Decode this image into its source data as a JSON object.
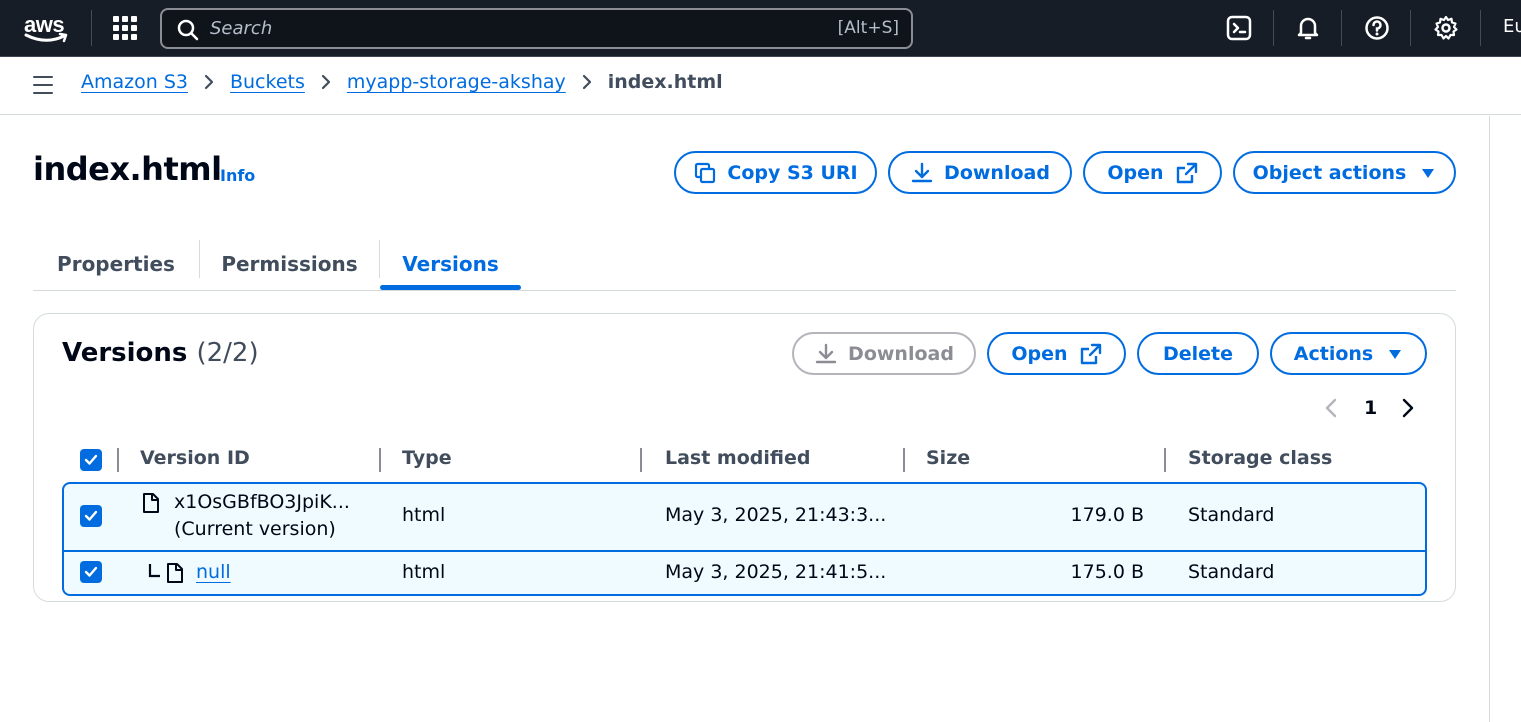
{
  "topnav": {
    "logo_text": "aws",
    "search": {
      "placeholder": "Search",
      "value": "",
      "shortcut": "[Alt+S]"
    },
    "region_label": "Eu",
    "icons": [
      "apps-grid-icon",
      "cloudshell-icon",
      "notifications-bell-icon",
      "help-icon",
      "settings-gear-icon"
    ]
  },
  "breadcrumb": {
    "items": [
      {
        "label": "Amazon S3"
      },
      {
        "label": "Buckets"
      },
      {
        "label": "myapp-storage-akshay"
      }
    ],
    "current": "index.html"
  },
  "header": {
    "title": "index.html",
    "info_label": "Info",
    "buttons": {
      "copy_uri": "Copy S3 URI",
      "download": "Download",
      "open": "Open",
      "object_actions": "Object actions"
    }
  },
  "tabs": [
    {
      "label": "Properties",
      "active": false
    },
    {
      "label": "Permissions",
      "active": false
    },
    {
      "label": "Versions",
      "active": true
    }
  ],
  "versions": {
    "title": "Versions",
    "count": "(2/2)",
    "buttons": {
      "download": "Download",
      "open": "Open",
      "delete": "Delete",
      "actions": "Actions"
    },
    "pagination": {
      "current_page": "1"
    },
    "columns": [
      "Version ID",
      "Type",
      "Last modified",
      "Size",
      "Storage class"
    ],
    "rows": [
      {
        "version_id": "x1OsGBfBO3JpiK...",
        "note": "(Current version)",
        "type": "html",
        "last_modified": "May 3, 2025, 21:43:3...",
        "size": "179.0 B",
        "storage_class": "Standard",
        "selected": true
      },
      {
        "version_id": "null",
        "type": "html",
        "last_modified": "May 3, 2025, 21:41:5...",
        "size": "175.0 B",
        "storage_class": "Standard",
        "selected": true
      }
    ]
  },
  "colors": {
    "accent": "#006ce0",
    "nav_bg": "#161d26",
    "selected_row_bg": "#f0fbff",
    "disabled": "#8c8c94"
  }
}
